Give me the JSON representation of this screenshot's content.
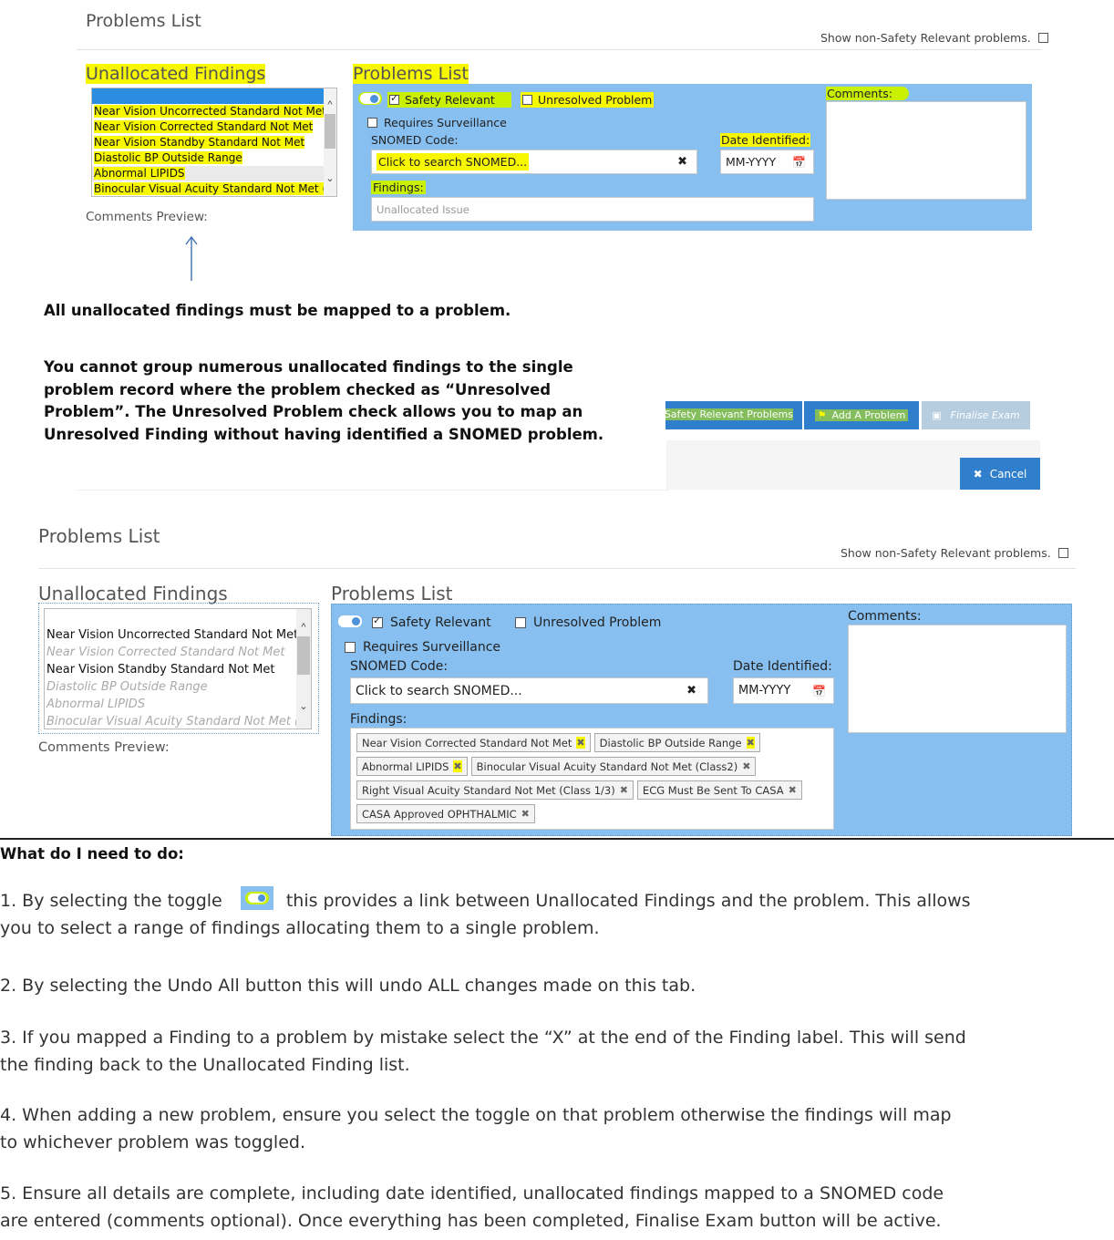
{
  "panel1": {
    "title": "Problems List",
    "show_non_safety": "Show non-Safety Relevant problems.",
    "unallocated_title": "Unallocated Findings",
    "unallocated_items": [
      "Near Vision Uncorrected Standard Not Met",
      "Near Vision Corrected Standard Not Met",
      "Near Vision Standby Standard Not Met",
      "Diastolic BP Outside Range",
      "Abnormal LIPIDS",
      "Binocular Visual Acuity Standard Not Met ("
    ],
    "comments_preview": "Comments Preview:",
    "problems_title": "Problems List",
    "safety_relevant": "Safety Relevant",
    "unresolved_problem": "Unresolved Problem",
    "requires_surveillance": "Requires Surveillance",
    "snomed_label": "SNOMED Code:",
    "snomed_placeholder": "Click to search SNOMED...",
    "date_label": "Date Identified:",
    "date_placeholder": "MM-YYYY",
    "findings_label": "Findings:",
    "findings_placeholder": "Unallocated Issue",
    "comments_label": "Comments:"
  },
  "note": {
    "line1": "All unallocated findings must be mapped to a problem.",
    "para": [
      "You cannot group numerous unallocated findings to the single",
      "problem record where the problem checked as “Unresolved",
      "Problem”. The Unresolved Problem check allows you to map an",
      "Unresolved Finding without having identified a SNOMED problem."
    ]
  },
  "buttons": {
    "safety_relevant_problems": "Safety Relevant Problems",
    "add_problem": "Add A Problem",
    "finalise_exam": "Finalise Exam",
    "cancel": "Cancel"
  },
  "panel2": {
    "title": "Problems List",
    "show_non_safety": "Show non-Safety Relevant problems.",
    "unallocated_title": "Unallocated Findings",
    "unallocated_items": [
      "Near Vision Uncorrected Standard Not Met",
      "Near Vision Corrected Standard Not Met",
      "Near Vision Standby Standard Not Met",
      "Diastolic BP Outside Range",
      "Abnormal LIPIDS",
      "Binocular Visual Acuity Standard Not Met ("
    ],
    "comments_preview": "Comments Preview:",
    "problems_title": "Problems List",
    "safety_relevant": "Safety Relevant",
    "unresolved_problem": "Unresolved Problem",
    "requires_surveillance": "Requires Surveillance",
    "snomed_label": "SNOMED Code:",
    "snomed_placeholder": "Click to search SNOMED...",
    "date_label": "Date Identified:",
    "date_placeholder": "MM-YYYY",
    "findings_label": "Findings:",
    "comments_label": "Comments:",
    "findings_tags": [
      "Near Vision Corrected Standard Not Met",
      "Diastolic BP Outside Range",
      "Abnormal LIPIDS",
      "Binocular Visual Acuity Standard Not Met (Class2)",
      "Right Visual Acuity Standard Not Met (Class 1/3)",
      "ECG Must Be Sent To CASA",
      "CASA Approved OPHTHALMIC"
    ]
  },
  "instructions": {
    "heading": "What do I need to do:",
    "step1_a": "1. By selecting the toggle",
    "step1_b": "this provides a link between Unallocated Findings and the problem. This allows",
    "step1_c": "you to select a range of findings allocating them to a single problem.",
    "step2": "2. By selecting the Undo All button this will undo ALL changes made on this tab.",
    "step3_a": "3. If you mapped a Finding to a problem by mistake select the “X” at the end of the Finding label. This will send",
    "step3_b": "the finding back to the Unallocated Finding list.",
    "step4_a": "4. When adding a new problem, ensure you select the toggle on that problem otherwise the findings will map",
    "step4_b": "to whichever problem was toggled.",
    "step5_a": "5. Ensure all details are complete, including date identified, unallocated findings mapped to a SNOMED code",
    "step5_b": "are entered (comments optional). Once everything has been completed, Finalise Exam button will be active."
  },
  "colors": {
    "panel_bg": "#87bff0",
    "highlight_yellow": "#f7f700",
    "highlight_green": "#c8f000",
    "button_blue": "#2f7fcc"
  }
}
